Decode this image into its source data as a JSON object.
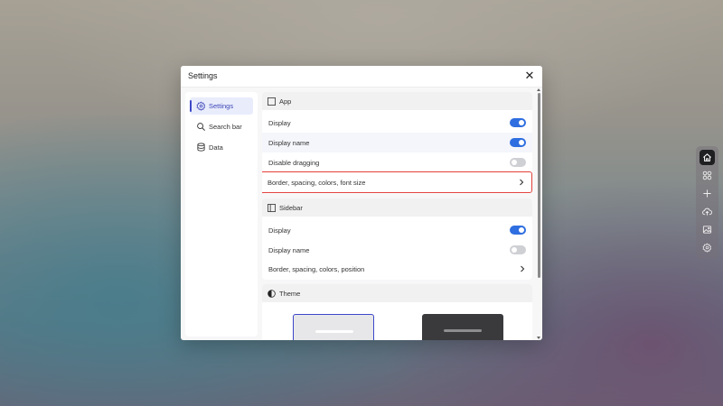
{
  "dialog": {
    "title": "Settings",
    "close_glyph": "✕"
  },
  "nav": {
    "items": [
      {
        "label": "Settings",
        "icon": "gear-icon",
        "active": true
      },
      {
        "label": "Search bar",
        "icon": "search-icon",
        "active": false
      },
      {
        "label": "Data",
        "icon": "database-icon",
        "active": false
      }
    ]
  },
  "sections": {
    "app": {
      "title": "App",
      "icon": "window-icon",
      "rows": [
        {
          "label": "Display",
          "type": "toggle",
          "on": true
        },
        {
          "label": "Display name",
          "type": "toggle",
          "on": true
        },
        {
          "label": "Disable dragging",
          "type": "toggle",
          "on": false
        },
        {
          "label": "Border, spacing, colors, font size",
          "type": "link",
          "selected": true
        }
      ]
    },
    "sidebar": {
      "title": "Sidebar",
      "icon": "sidebar-layout-icon",
      "rows": [
        {
          "label": "Display",
          "type": "toggle",
          "on": true
        },
        {
          "label": "Display name",
          "type": "toggle",
          "on": false
        },
        {
          "label": "Border, spacing, colors, position",
          "type": "link"
        }
      ]
    },
    "theme": {
      "title": "Theme",
      "icon": "contrast-icon",
      "options": [
        {
          "name": "light",
          "selected": true
        },
        {
          "name": "dark",
          "selected": false
        }
      ]
    }
  },
  "dock": {
    "items": [
      {
        "icon": "home-icon",
        "active": true
      },
      {
        "icon": "apps-icon",
        "active": false
      },
      {
        "icon": "plus-icon",
        "active": false
      },
      {
        "icon": "cloud-upload-icon",
        "active": false
      },
      {
        "icon": "image-icon",
        "active": false
      },
      {
        "icon": "gear-icon",
        "active": false
      }
    ]
  },
  "colors": {
    "accent": "#2f6ee0",
    "nav_active": "#3c46b8",
    "selection_outline": "#e2403a",
    "theme_light": "#e7e7e9",
    "theme_dark": "#3a3a3c"
  }
}
